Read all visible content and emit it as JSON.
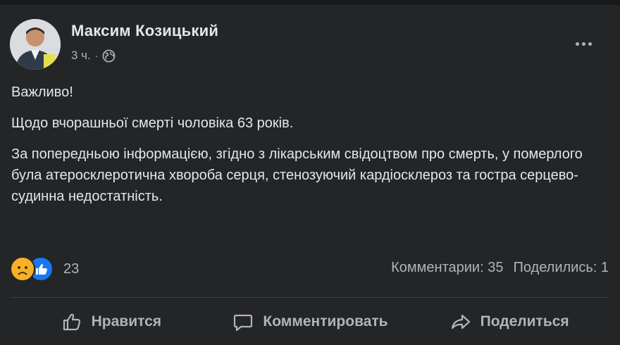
{
  "post": {
    "author": "Максим Козицький",
    "time": "3 ч.",
    "separator": "·",
    "privacy_icon": "globe-icon",
    "more_icon": "more-options-icon",
    "paragraphs": [
      "Важливо!",
      "Щодо вчорашньої смерті чоловіка 63 років.",
      "За попередньою інформацією, згідно з лікарським свідоцтвом про смерть, у померлого була атеросклеротична хвороба серця, стенозуючий кардіосклероз та гостра серцево-судинна недостатність."
    ],
    "reactions": {
      "icons": [
        "sad-reaction-icon",
        "like-reaction-icon"
      ],
      "count": "23"
    },
    "comments_text": "Комментарии: 35",
    "shares_text": "Поделились: 1"
  },
  "actions": {
    "like": "Нравится",
    "comment": "Комментировать",
    "share": "Поделиться"
  },
  "colors": {
    "background": "#18191a",
    "card": "#242526",
    "primary_text": "#e4e6eb",
    "secondary_text": "#b0b3b8",
    "like_blue": "#1877f2",
    "sad_yellow": "#f7b125"
  }
}
